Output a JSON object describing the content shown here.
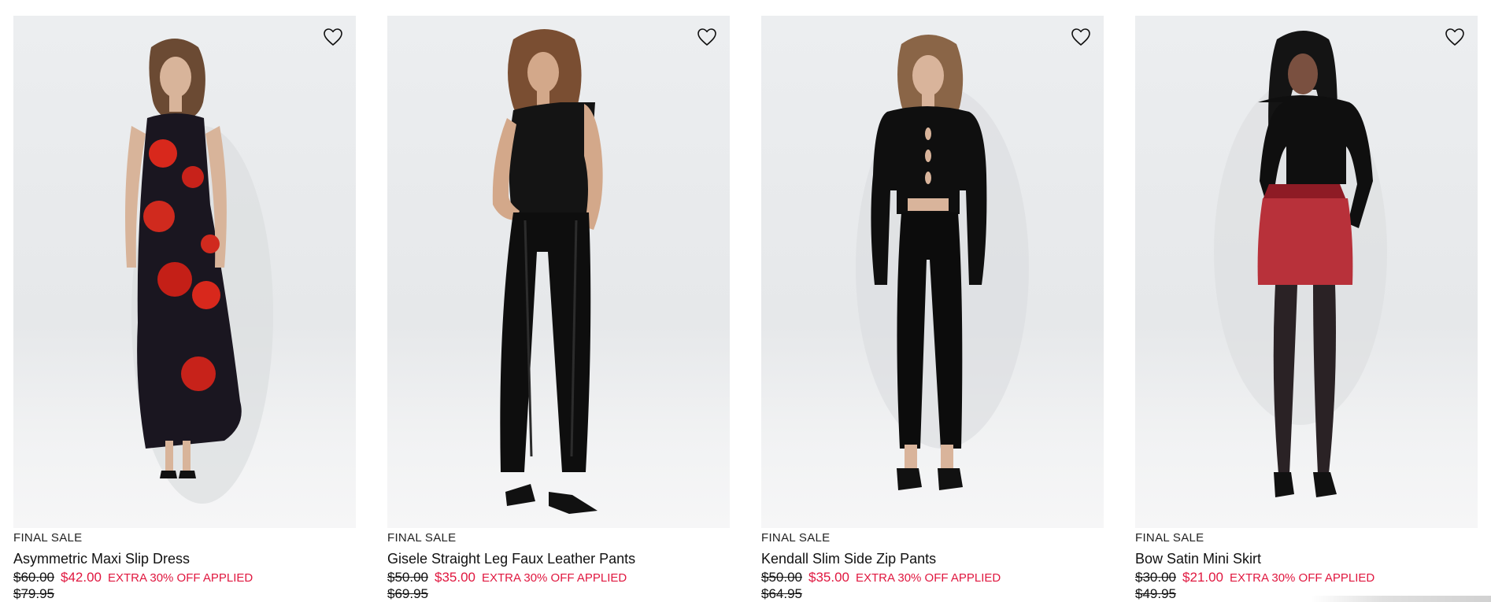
{
  "products": [
    {
      "badge": "FINAL SALE",
      "name": "Asymmetric Maxi Slip Dress",
      "was_price": "$60.00",
      "sale_price": "$42.00",
      "promo": "EXTRA 30% OFF APPLIED",
      "original_price": "$79.95"
    },
    {
      "badge": "FINAL SALE",
      "name": "Gisele Straight Leg Faux Leather Pants",
      "was_price": "$50.00",
      "sale_price": "$35.00",
      "promo": "EXTRA 30% OFF APPLIED",
      "original_price": "$69.95"
    },
    {
      "badge": "FINAL SALE",
      "name": "Kendall Slim Side Zip Pants",
      "was_price": "$50.00",
      "sale_price": "$35.00",
      "promo": "EXTRA 30% OFF APPLIED",
      "original_price": "$64.95"
    },
    {
      "badge": "FINAL SALE",
      "name": "Bow Satin Mini Skirt",
      "was_price": "$30.00",
      "sale_price": "$21.00",
      "promo": "EXTRA 30% OFF APPLIED",
      "original_price": "$49.95"
    }
  ],
  "icons": {
    "wishlist": "heart-outline-icon"
  },
  "colors": {
    "sale": "#e0173f",
    "text": "#111111",
    "image_bg": "#e8eaec"
  }
}
